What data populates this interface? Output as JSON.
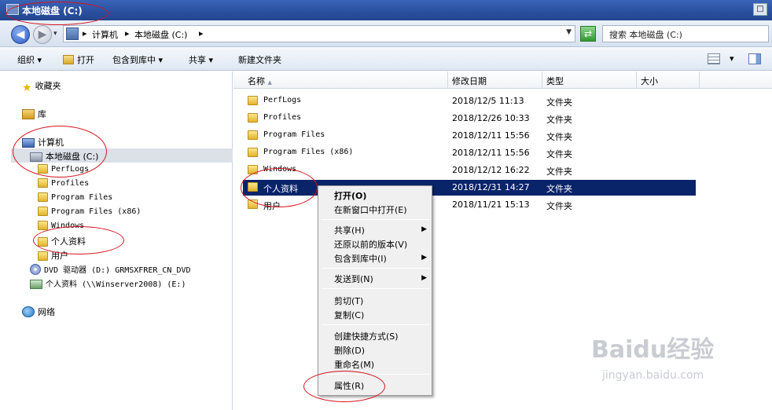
{
  "window": {
    "title": "本地磁盘 (C:)",
    "restore_label": "□"
  },
  "address": {
    "crumbs": [
      "计算机",
      "本地磁盘 (C:)"
    ],
    "search_placeholder": "搜索 本地磁盘 (C:)"
  },
  "toolbar": {
    "organize": "组织 ▾",
    "open": "打开",
    "include": "包含到库中 ▾",
    "share": "共享 ▾",
    "new_folder": "新建文件夹"
  },
  "nav": {
    "favorites": "收藏夹",
    "libraries": "库",
    "computer": "计算机",
    "local_disk": "本地磁盘 (C:)",
    "folders": [
      "PerfLogs",
      "Profiles",
      "Program Files",
      "Program Files (x86)",
      "Windows",
      "个人资料",
      "用户"
    ],
    "dvd": "DVD 驱动器 (D:) GRMSXFRER_CN_DVD",
    "net_drive": "个人资料 (\\\\Winserver2008) (E:)",
    "network": "网络"
  },
  "columns": {
    "name": "名称",
    "sort_arrow": "▲",
    "modified": "修改日期",
    "type": "类型",
    "size": "大小"
  },
  "files": [
    {
      "name": "PerfLogs",
      "date": "2018/12/5 11:13",
      "type": "文件夹"
    },
    {
      "name": "Profiles",
      "date": "2018/12/26 10:33",
      "type": "文件夹"
    },
    {
      "name": "Program Files",
      "date": "2018/12/11 15:56",
      "type": "文件夹"
    },
    {
      "name": "Program Files (x86)",
      "date": "2018/12/11 15:56",
      "type": "文件夹"
    },
    {
      "name": "Windows",
      "date": "2018/12/12 16:22",
      "type": "文件夹"
    },
    {
      "name": "个人资料",
      "date": "2018/12/31 14:27",
      "type": "文件夹"
    },
    {
      "name": "用户",
      "date": "2018/11/21 15:13",
      "type": "文件夹"
    }
  ],
  "context_menu": {
    "open": "打开(O)",
    "open_new_window": "在新窗口中打开(E)",
    "share": "共享(H)",
    "restore_versions": "还原以前的版本(V)",
    "include_library": "包含到库中(I)",
    "send_to": "发送到(N)",
    "cut": "剪切(T)",
    "copy": "复制(C)",
    "create_shortcut": "创建快捷方式(S)",
    "delete": "删除(D)",
    "rename": "重命名(M)",
    "properties": "属性(R)",
    "submenu_arrow": "▶"
  },
  "watermark": {
    "brand": "Baidu经验",
    "url": "jingyan.baidu.com"
  },
  "colors": {
    "selection": "#0a246a",
    "annotation": "#d4141e",
    "titlebar": "#2a4f9e"
  }
}
